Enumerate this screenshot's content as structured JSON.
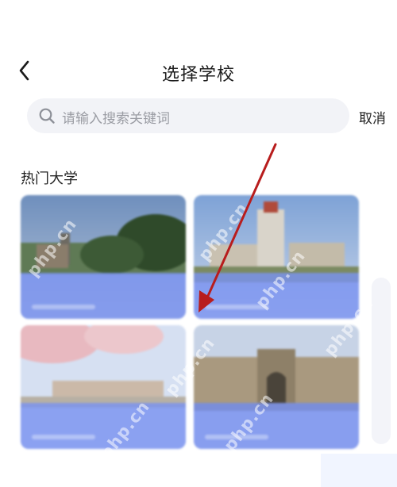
{
  "header": {
    "title": "选择学校"
  },
  "search": {
    "placeholder": "请输入搜索关键词",
    "cancel_label": "取消"
  },
  "section": {
    "title": "热门大学"
  },
  "universities": [
    {
      "name": "",
      "scene": "campus-lawn"
    },
    {
      "name": "",
      "scene": "tower-building"
    },
    {
      "name": "",
      "scene": "cherry-blossom"
    },
    {
      "name": "",
      "scene": "library-building"
    }
  ],
  "watermark": "php.cn",
  "colors": {
    "card_band": "#7a92f0",
    "annotation_arrow": "#b81d1d",
    "search_bg": "#f2f3f7"
  }
}
